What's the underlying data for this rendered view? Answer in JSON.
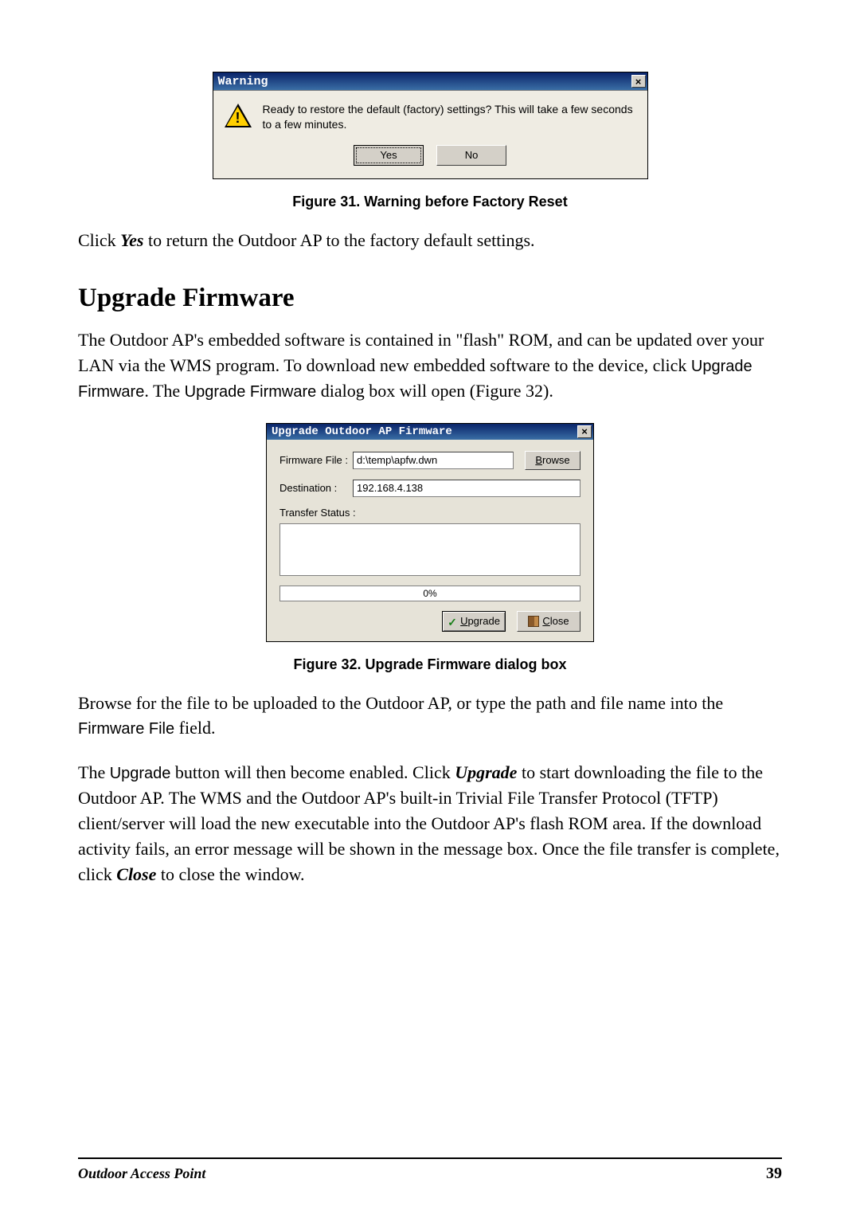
{
  "warning_dialog": {
    "title": "Warning",
    "close_glyph": "×",
    "message": "Ready to restore the default (factory) settings? This will take a few seconds to a few minutes.",
    "yes_label": "Yes",
    "no_label": "No"
  },
  "figure31_caption": "Figure 31.  Warning before Factory Reset",
  "para_click_yes": {
    "pre": "Click ",
    "yes": "Yes",
    "post": " to return the Outdoor AP to the factory default settings."
  },
  "section_title": "Upgrade Firmware",
  "para_firmware_intro": {
    "p1": "The Outdoor AP's embedded software is contained in \"flash\" ROM, and can be updated over your LAN via the WMS program. To download new embedded software to the device, click ",
    "cmd1": "Upgrade Firmware",
    "mid": ". The ",
    "cmd2": "Upgrade Firmware",
    "p2": " dialog box will open (Figure 32)."
  },
  "fw_dialog": {
    "title": "Upgrade Outdoor AP Firmware",
    "close_glyph": "×",
    "firmware_file_label": "Firmware File :",
    "firmware_file_value": "d:\\temp\\apfw.dwn",
    "browse_label": "Browse",
    "destination_label": "Destination :",
    "destination_value": "192.168.4.138",
    "transfer_status_label": "Transfer Status :",
    "progress_text": "0%",
    "upgrade_label": "Upgrade",
    "close_label": "Close"
  },
  "figure32_caption": "Figure 32.  Upgrade Firmware dialog box",
  "para_browse": {
    "p1": "Browse for the file to be uploaded to the Outdoor AP, or type the path and file name into the ",
    "field": "Firmware File",
    "p2": " field."
  },
  "para_upgrade": {
    "p1": "The ",
    "cmd": "Upgrade",
    "p2": " button will then become enabled. Click ",
    "bi1": "Upgrade",
    "p3": " to start downloading the file to the Outdoor AP. The WMS and the Outdoor AP's built-in Trivial File Transfer Protocol (TFTP) client/server will load the new executable into the Outdoor AP's flash ROM area. If the download activity fails, an error message will be shown in the message box. Once the file transfer is complete, click ",
    "bi2": "Close",
    "p4": " to close the window."
  },
  "footer": {
    "title": "Outdoor Access Point",
    "page": "39"
  }
}
